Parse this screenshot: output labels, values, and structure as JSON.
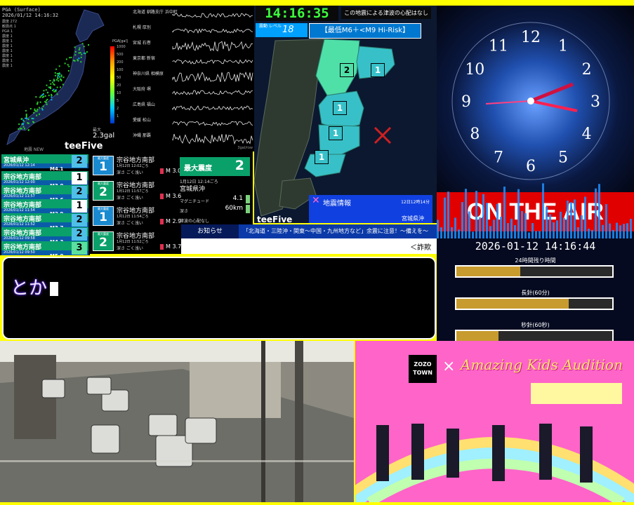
{
  "map_panel": {
    "header": "PGA (Surface)",
    "timestamp": "2026/01/12 14:16:32",
    "stats": [
      "震度 272",
      "観測点 1",
      "PGA 1",
      "震度 1",
      "震度 1",
      "震度 1",
      "震度 1",
      "震度 1",
      "震度 1",
      "震度 1"
    ],
    "scale_title": "PGA[gal]",
    "scale_labels": [
      "1000",
      "500",
      "200",
      "100",
      "50",
      "20",
      "10",
      "5",
      "2",
      "1"
    ],
    "gal_label": "最大",
    "gal_value": "2.3gal",
    "news": "地震 NEW",
    "logo": "teeFive"
  },
  "seismograph": {
    "stations": [
      "北海道 釧路支庁 浜中町",
      "札幌 厚別",
      "宮城 石巻",
      "東京都 新宿",
      "神奈川県 相模原",
      "大阪府 堺",
      "広島県 福山",
      "愛媛 松山",
      "沖縄 那覇"
    ],
    "unit": "3gal/row"
  },
  "events": [
    {
      "region": "宗谷地方南部",
      "date": "2026/01/12 12:00",
      "mag": "M3.0",
      "intensity": "1",
      "color": "#ffffff"
    },
    {
      "region": "宗谷地方南部",
      "date": "2026/01/12 11:57",
      "mag": "M3.6",
      "intensity": "2",
      "color": "#4fbfe8"
    },
    {
      "region": "宗谷地方南部",
      "date": "2026/01/12 11:54",
      "mag": "M2.9",
      "intensity": "1",
      "color": "#ffffff"
    },
    {
      "region": "宗谷地方南部",
      "date": "2026/01/12 11:52",
      "mag": "M3.7",
      "intensity": "2",
      "color": "#4fbfe8"
    },
    {
      "region": "宗谷地方南部",
      "date": "2026/01/12 09:58",
      "mag": "M4.3",
      "intensity": "2",
      "color": "#4fbfe8"
    },
    {
      "region": "宗谷地方南部",
      "date": "2026/01/12 09:50",
      "mag": "M5.0",
      "intensity": "3",
      "color": "#5be0a0"
    }
  ],
  "events_first": {
    "region": "宮城県沖",
    "date": "2026/01/12 12:14",
    "mag": "M4.1",
    "intensity": "2"
  },
  "details": [
    {
      "label": "最大震度",
      "intensity": "1",
      "region": "宗谷地方南部",
      "time": "1月12日 12:02ごろ",
      "depth": "深さ ごく浅い",
      "mag": "3.0"
    },
    {
      "label": "最大震度",
      "intensity": "2",
      "region": "宗谷地方南部",
      "time": "1月12日 11:57ごろ",
      "depth": "深さ ごく浅い",
      "mag": "3.6"
    },
    {
      "label": "最大震度",
      "intensity": "1",
      "region": "宗谷地方南部",
      "time": "1月12日 11:54ごろ",
      "depth": "深さ ごく浅い",
      "mag": "2.9"
    },
    {
      "label": "最大震度",
      "intensity": "2",
      "region": "宗谷地方南部",
      "time": "1月12日 11:52ごろ",
      "depth": "深さ ごく浅い",
      "mag": "3.7"
    }
  ],
  "summary": {
    "max_label": "最大震度",
    "max_value": "2",
    "region": "宮城県沖",
    "time": "1月12日 12:14ごろ",
    "magnitude_label": "マグニチュード",
    "magnitude": "4.1",
    "depth_label": "深さ",
    "depth": "60km",
    "tsunami": "津波の心配なし"
  },
  "shindo_map": {
    "clock": "14:16:35",
    "no_tsunami": "この地震による津波の心配はなし",
    "level_label": "震動 レベル",
    "level_value": "18",
    "risk": "【最低M6＋<M9 Hi-Risk】",
    "regions": [
      "2",
      "1",
      "1",
      "1",
      "1"
    ],
    "logo": "teeFive",
    "info_title": "地震情報",
    "info_time": "12日12時14分",
    "info_region": "宮城県沖"
  },
  "ticker": {
    "label": "お知らせ",
    "message": "「北海道・三陸沖・関東〜中国・九州地方など」余震に注意！〜備えを〜",
    "scam": "＜詐欺"
  },
  "input": {
    "text": "とか"
  },
  "clock_panel": {
    "numbers": [
      "12",
      "1",
      "2",
      "3",
      "4",
      "5",
      "6",
      "7",
      "8",
      "9",
      "10",
      "11"
    ],
    "onair": "ON THE AIR",
    "datetime": "2026-01-12 14:16:44",
    "remaining": [
      {
        "label": "24時間残り時間",
        "fraction": 0.41
      },
      {
        "label": "長針(60分)",
        "fraction": 0.72
      },
      {
        "label": "秒針(60秒)",
        "fraction": 0.27
      }
    ]
  },
  "promo": {
    "brand": "ZOZO TOWN",
    "cross": "×",
    "title": "Amazing Kids Audition"
  }
}
